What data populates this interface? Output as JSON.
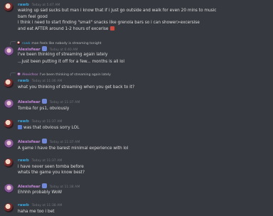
{
  "messages": [
    {
      "author": "rawb",
      "time": "Today at 5:47 AM",
      "lines": [
        "waking up sad sucks but man i know that if i just go outside and walk for even 20 mins to music",
        "bam feel good",
        "i think i need to start finding \"small\" snacks like grenola bars so i can shower>excersise",
        "and eat AFTER around 1-2 hours of excerise"
      ]
    },
    {
      "reply_to": {
        "author": "rawb",
        "text": "man feels like nobody is streaming tonight"
      },
      "author": "Alexisfear",
      "time": "Today at 6:40 AM",
      "lines": [
        "I've been thinking of streaming again lately",
        "...just been putting it off for a few... months is all lol"
      ]
    },
    {
      "reply_to": {
        "author": "Alexisfear",
        "text": "I've been thinking of streaming again lately"
      },
      "author": "rawb",
      "time": "Today at 11:36 AM",
      "lines": [
        "what you thinking of streaming when you get back to it?"
      ]
    },
    {
      "author": "Alexisfear",
      "time": "Today at 11:37 AM",
      "lines": [
        "Tomba for ps1, obviously"
      ]
    },
    {
      "author": "rawb",
      "time": "Today at 11:37 AM",
      "lines": [
        "was that obvious sorry LOL"
      ]
    },
    {
      "author": "Alexisfear",
      "time": "Today at 11:37 AM",
      "lines": [
        "A game I have the barest minimal experience with lol"
      ]
    },
    {
      "author": "rawb",
      "time": "Today at 11:37 AM",
      "lines": [
        "i have never seen tomba before",
        "whats the game you know best?"
      ]
    },
    {
      "author": "Alexisfear",
      "time": "Today at 11:38 AM",
      "lines": [
        "Ehhhh probably WoW"
      ]
    },
    {
      "author": "rawb",
      "time": "Today at 11:38 AM",
      "lines": [
        "haha me too i bet"
      ]
    }
  ]
}
